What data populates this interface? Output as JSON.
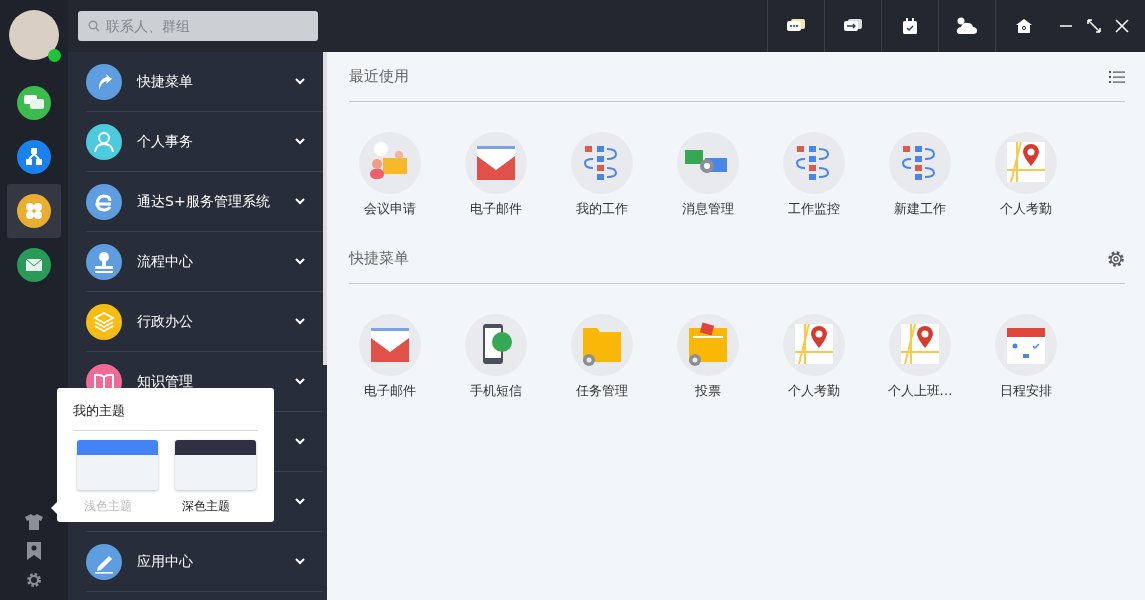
{
  "user": {
    "online": true
  },
  "rail": {
    "items": [
      {
        "selected": false,
        "color": "#3dbb4e"
      },
      {
        "selected": false,
        "color": "#1a82f0"
      },
      {
        "selected": true,
        "color": "#e9ad2f"
      },
      {
        "selected": false,
        "color": "#2a9a58"
      }
    ]
  },
  "search": {
    "placeholder": "联系人、群组"
  },
  "menu": {
    "items": [
      {
        "kind": "entry",
        "label": "快捷菜单",
        "color": "#5d9de0"
      },
      {
        "kind": "entry",
        "label": "个人事务",
        "color": "#4ccbdc"
      },
      {
        "kind": "entry",
        "label": "通达S+服务管理系统",
        "color": "#5d9de0"
      },
      {
        "kind": "entry",
        "label": "流程中心",
        "color": "#5d9de0"
      },
      {
        "kind": "entry",
        "label": "行政办公",
        "color": "#f7bd12"
      },
      {
        "kind": "entry",
        "label": "知识管理",
        "color": "#ef6a94"
      },
      {
        "kind": "covered"
      },
      {
        "kind": "covered"
      },
      {
        "kind": "entry",
        "label": "应用中心",
        "color": "#5d9de0"
      }
    ]
  },
  "theme_popup": {
    "title": "我的主题",
    "options": [
      {
        "label": "浅色主题",
        "color": "#4483f5",
        "selected": false
      },
      {
        "label": "深色主题",
        "color": "#2e3142",
        "selected": true
      }
    ]
  },
  "sections": [
    {
      "title": "最近使用",
      "apps": [
        {
          "label": "会议申请"
        },
        {
          "label": "电子邮件"
        },
        {
          "label": "我的工作"
        },
        {
          "label": "消息管理"
        },
        {
          "label": "工作监控"
        },
        {
          "label": "新建工作"
        },
        {
          "label": "个人考勤"
        }
      ]
    },
    {
      "title": "快捷菜单",
      "apps": [
        {
          "label": "电子邮件"
        },
        {
          "label": "手机短信"
        },
        {
          "label": "任务管理"
        },
        {
          "label": "投票"
        },
        {
          "label": "个人考勤"
        },
        {
          "label": "个人上班…"
        },
        {
          "label": "日程安排"
        }
      ]
    }
  ]
}
